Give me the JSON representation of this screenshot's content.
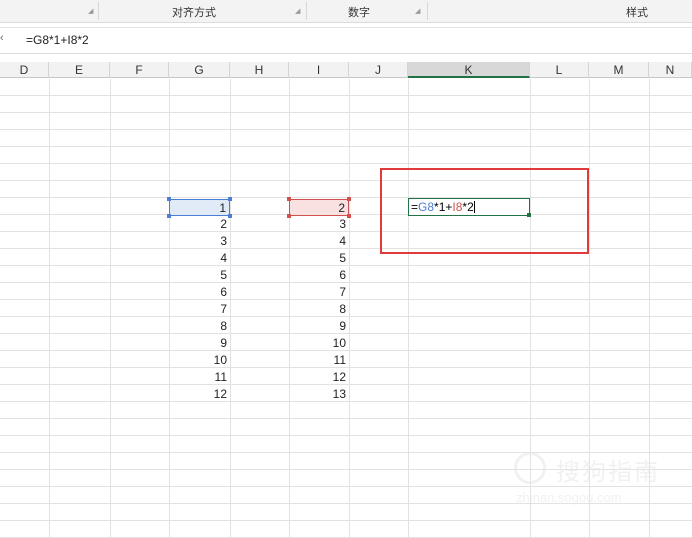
{
  "ribbon": {
    "groups": [
      "对齐方式",
      "数字",
      "样式"
    ]
  },
  "formula_bar": {
    "content": "=G8*1+I8*2"
  },
  "columns": [
    "D",
    "E",
    "F",
    "G",
    "H",
    "I",
    "J",
    "K",
    "L",
    "M",
    "N"
  ],
  "active_column": "K",
  "column_g_values": [
    "1",
    "2",
    "3",
    "4",
    "5",
    "6",
    "7",
    "8",
    "9",
    "10",
    "11",
    "12"
  ],
  "column_i_values": [
    "2",
    "3",
    "4",
    "5",
    "6",
    "7",
    "8",
    "9",
    "10",
    "11",
    "12",
    "13"
  ],
  "editing_cell": {
    "eq": "=",
    "ref1": "G8",
    "mid": "*1+",
    "ref2": "I8",
    "tail": "*2"
  },
  "colors": {
    "ref1": "#4a7fd4",
    "ref2": "#d05050",
    "active_border": "#217346",
    "callout": "#e03a3a"
  },
  "watermark": {
    "brand": "搜狗指南",
    "url": "zhinan.sogou.com"
  }
}
